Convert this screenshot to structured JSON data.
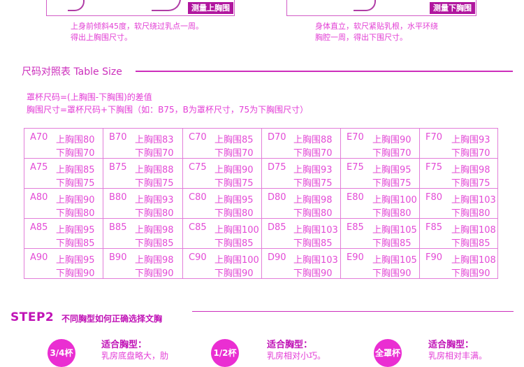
{
  "top": {
    "left_badge": "测量上胸围",
    "right_badge": "测量下胸围",
    "left_caption_1": "上身前倾斜45度，软尺绕过乳点一周。",
    "left_caption_2": "得出上胸围尺寸。",
    "right_caption_1": "身体直立，软尺紧贴乳根，水平环绕",
    "right_caption_2": "胸腔一周，得出下围尺寸。"
  },
  "table_section": {
    "title": "尺码对照表 Table Size",
    "note_1": "罩杯尺码=(上胸围-下胸围)的差值",
    "note_2": "胸围尺寸=罩杯尺码+下胸围（如：B75，B为罩杯尺寸，75为下胸围尺寸）"
  },
  "size_table": [
    [
      {
        "size": "A70",
        "up": "上胸围80",
        "down": "下胸围70"
      },
      {
        "size": "B70",
        "up": "上胸围83",
        "down": "下胸围70"
      },
      {
        "size": "C70",
        "up": "上胸围85",
        "down": "下胸围70"
      },
      {
        "size": "D70",
        "up": "上胸围88",
        "down": "下胸围70"
      },
      {
        "size": "E70",
        "up": "上胸围90",
        "down": "下胸围70"
      },
      {
        "size": "F70",
        "up": "上胸围93",
        "down": "下胸围70"
      }
    ],
    [
      {
        "size": "A75",
        "up": "上胸围85",
        "down": "下胸围75"
      },
      {
        "size": "B75",
        "up": "上胸围88",
        "down": "下胸围75"
      },
      {
        "size": "C75",
        "up": "上胸围90",
        "down": "下胸围75"
      },
      {
        "size": "D75",
        "up": "上胸围93",
        "down": "下胸围75"
      },
      {
        "size": "E75",
        "up": "上胸围95",
        "down": "下胸围75"
      },
      {
        "size": "F75",
        "up": "上胸围98",
        "down": "下胸围75"
      }
    ],
    [
      {
        "size": "A80",
        "up": "上胸围90",
        "down": "下胸围80"
      },
      {
        "size": "B80",
        "up": "上胸围93",
        "down": "下胸围80"
      },
      {
        "size": "C80",
        "up": "上胸围95",
        "down": "下胸围80"
      },
      {
        "size": "D80",
        "up": "上胸围98",
        "down": "下胸围80"
      },
      {
        "size": "E80",
        "up": "上胸围100",
        "down": "下胸围80"
      },
      {
        "size": "F80",
        "up": "上胸围103",
        "down": "下胸围80"
      }
    ],
    [
      {
        "size": "A85",
        "up": "上胸围95",
        "down": "下胸围85"
      },
      {
        "size": "B85",
        "up": "上胸围98",
        "down": "下胸围85"
      },
      {
        "size": "C85",
        "up": "上胸围100",
        "down": "下胸围85"
      },
      {
        "size": "D85",
        "up": "上胸围103",
        "down": "下胸围85"
      },
      {
        "size": "E85",
        "up": "上胸围105",
        "down": "下胸围85"
      },
      {
        "size": "F85",
        "up": "上胸围108",
        "down": "下胸围85"
      }
    ],
    [
      {
        "size": "A90",
        "up": "上胸围95",
        "down": "下胸围90"
      },
      {
        "size": "B90",
        "up": "上胸围98",
        "down": "下胸围90"
      },
      {
        "size": "C90",
        "up": "上胸围100",
        "down": "下胸围90"
      },
      {
        "size": "D90",
        "up": "上胸围103",
        "down": "下胸围90"
      },
      {
        "size": "E90",
        "up": "上胸围105",
        "down": "下胸围90"
      },
      {
        "size": "F90",
        "up": "上胸围108",
        "down": "下胸围90"
      }
    ]
  ],
  "step2": {
    "title": "STEP2",
    "subtitle": "不同胸型如何正确选择文胸",
    "cups": [
      {
        "badge": "3/4杯",
        "fit_title": "适合胸型：",
        "fit_desc": "乳房底盘略大，肋"
      },
      {
        "badge": "1/2杯",
        "fit_title": "适合胸型：",
        "fit_desc": "乳房相对小巧。"
      },
      {
        "badge": "全罩杯",
        "fit_title": "适合胸型：",
        "fit_desc": "乳房相对丰满。"
      }
    ]
  },
  "colors": {
    "accent": "#e33cd6",
    "dark_accent": "#c012b6",
    "badge_bg": "#b0169e",
    "circle_bg": "#ea2ed2"
  }
}
